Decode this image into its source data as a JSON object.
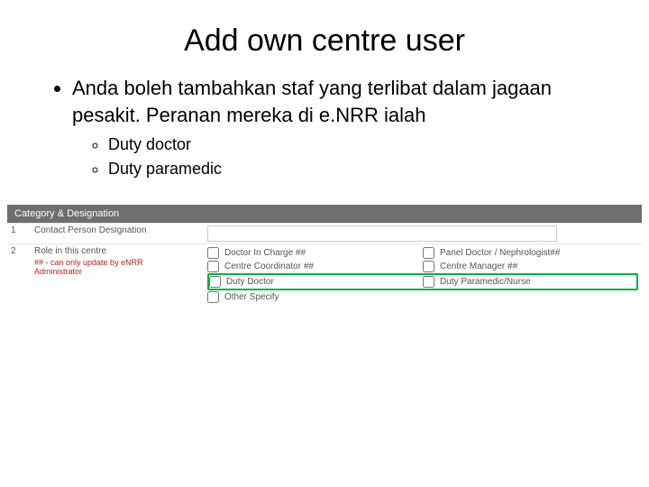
{
  "slide": {
    "title": "Add own centre user",
    "bullet1": "Anda boleh tambahkan staf yang terlibat dalam jagaan pesakit. Peranan mereka di e.NRR ialah",
    "sub1": "Duty doctor",
    "sub2": "Duty paramedic"
  },
  "section_header": "Category & Designation",
  "row1": {
    "num": "1",
    "label": "Contact Person Designation"
  },
  "row2": {
    "num": "2",
    "label": "Role in this centre",
    "note": "## - can only update by eNRR Administrator",
    "options": {
      "doctor_in_charge": "Doctor In Charge ##",
      "panel_doctor": "Panel Doctor / Nephrologist##",
      "centre_coordinator": "Centre Coordinator ##",
      "centre_manager": "Centre Manager ##",
      "duty_doctor": "Duty Doctor",
      "duty_paramedic": "Duty Paramedic/Nurse",
      "other_specify": "Other Specify"
    }
  }
}
